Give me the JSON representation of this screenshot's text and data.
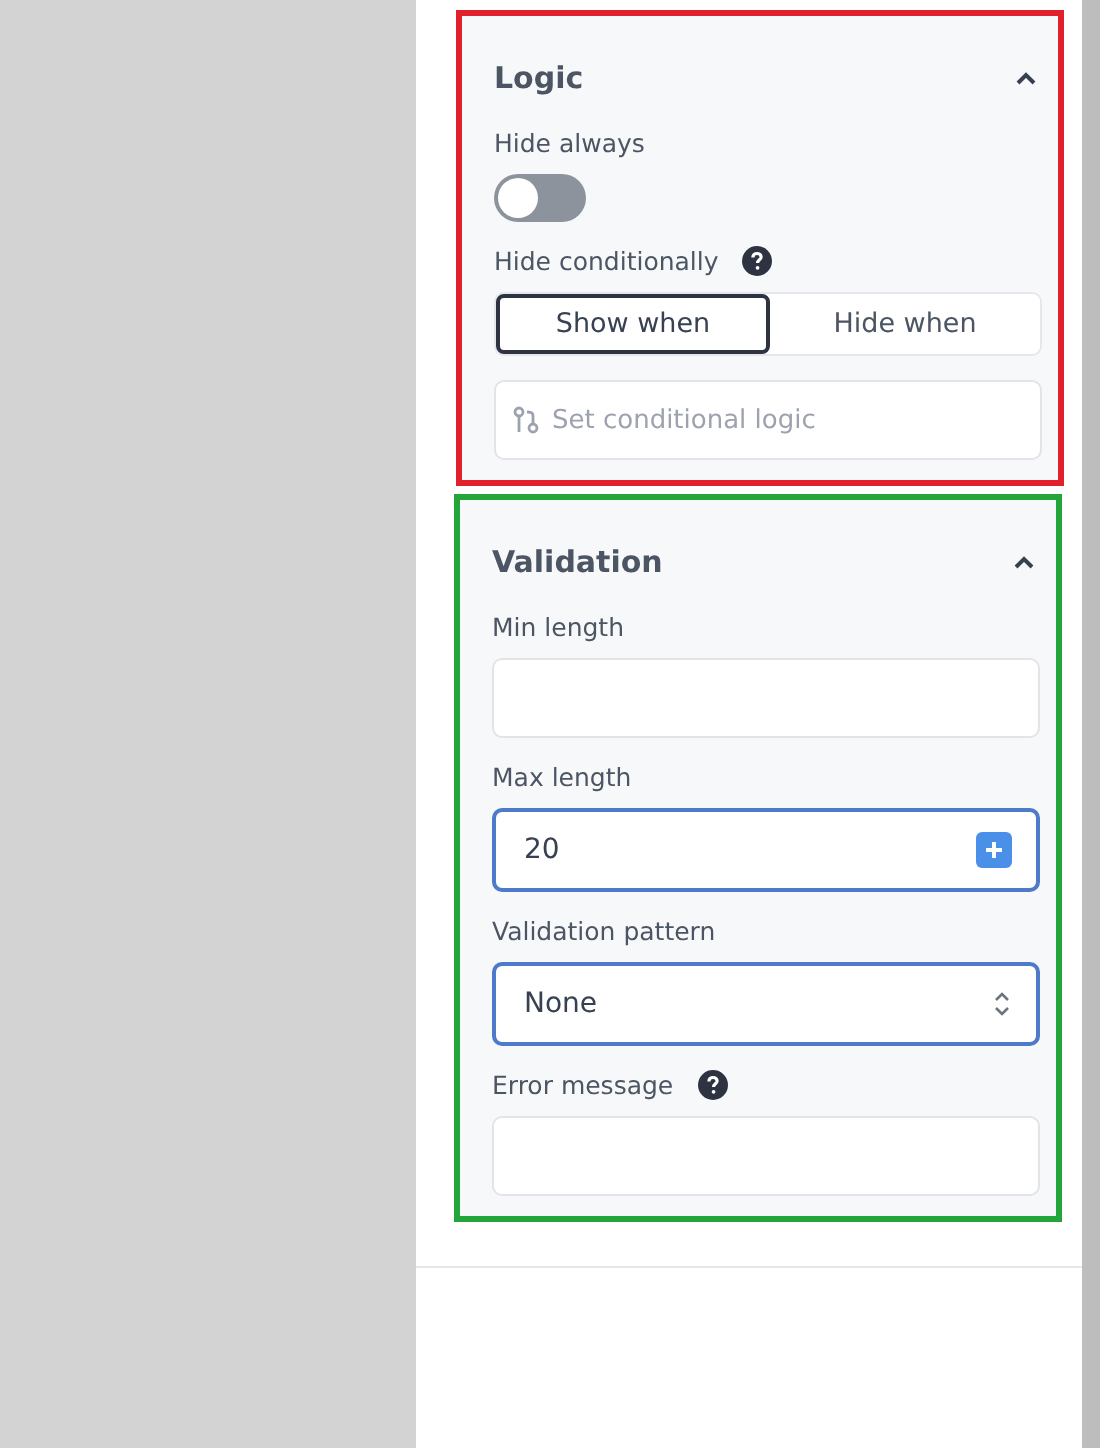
{
  "sections": [
    {
      "title": "Logic",
      "expanded": true,
      "color": "#e0202a",
      "items": [
        {
          "kind": "toggle",
          "label": "Hide always",
          "on": false
        },
        {
          "kind": "segmented",
          "label": "Hide conditionally",
          "help": true,
          "options": [
            {
              "label": "Show when",
              "selected": true
            },
            {
              "label": "Hide when",
              "selected": false
            }
          ]
        },
        {
          "kind": "logic",
          "placeholder": "Set conditional logic"
        }
      ]
    },
    {
      "title": "Validation",
      "expanded": true,
      "color": "#22a63a",
      "items": [
        {
          "kind": "input",
          "label": "Min length",
          "focused": false
        },
        {
          "kind": "number",
          "label": "Max length",
          "value": "20",
          "focused": true
        },
        {
          "kind": "select",
          "label": "Validation pattern",
          "value": "None",
          "focused": true
        },
        {
          "kind": "input",
          "label": "Error message",
          "help": true,
          "focused": false
        }
      ]
    }
  ]
}
